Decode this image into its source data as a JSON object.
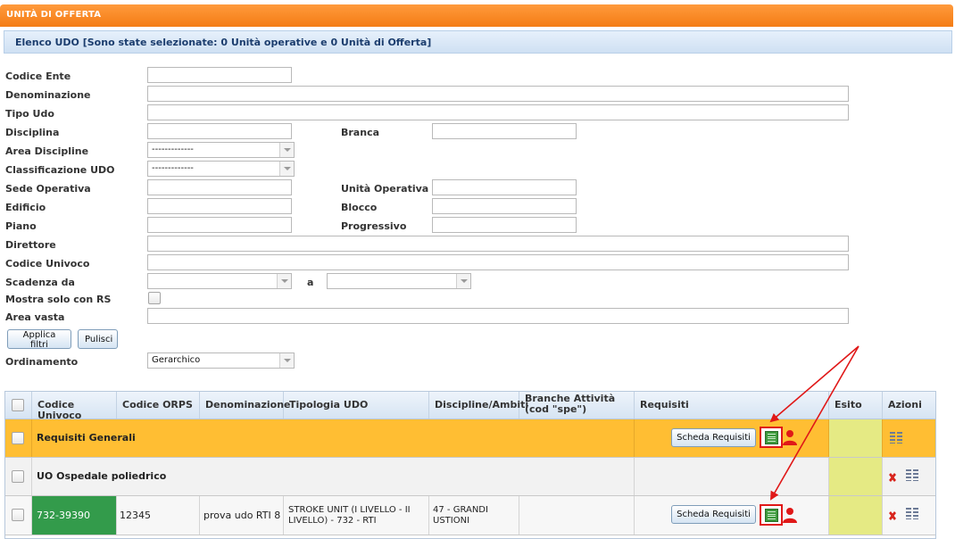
{
  "header": {
    "title": "UNITÀ DI OFFERTA",
    "subtitle": "Elenco UDO [Sono state selezionate: 0 Unità operative e 0 Unità di Offerta]"
  },
  "filters": {
    "codice_ente": {
      "label": "Codice Ente",
      "value": ""
    },
    "denominazione": {
      "label": "Denominazione",
      "value": ""
    },
    "tipo_udo": {
      "label": "Tipo Udo",
      "value": ""
    },
    "disciplina": {
      "label": "Disciplina",
      "value": ""
    },
    "branca": {
      "label": "Branca",
      "value": ""
    },
    "area_discipline": {
      "label": "Area Discipline",
      "value": "-------------"
    },
    "classificazione_udo": {
      "label": "Classificazione UDO",
      "value": "-------------"
    },
    "sede_operativa": {
      "label": "Sede Operativa",
      "value": ""
    },
    "unita_operativa": {
      "label": "Unità Operativa",
      "value": ""
    },
    "edificio": {
      "label": "Edificio",
      "value": ""
    },
    "blocco": {
      "label": "Blocco",
      "value": ""
    },
    "piano": {
      "label": "Piano",
      "value": ""
    },
    "progressivo": {
      "label": "Progressivo",
      "value": ""
    },
    "direttore": {
      "label": "Direttore",
      "value": ""
    },
    "codice_univoco": {
      "label": "Codice Univoco",
      "value": ""
    },
    "scadenza_da": {
      "label": "Scadenza da",
      "value": ""
    },
    "scadenza_a": {
      "label": "a",
      "value": ""
    },
    "mostra_solo_rs": {
      "label": "Mostra solo con RS",
      "checked": false
    },
    "area_vasta": {
      "label": "Area vasta",
      "value": ""
    },
    "applica_label": "Applica filtri",
    "pulisci_label": "Pulisci",
    "ordinamento": {
      "label": "Ordinamento",
      "value": "Gerarchico"
    }
  },
  "table": {
    "columns": [
      "Codice Univoco",
      "Codice ORPS",
      "Denominazione",
      "Tipologia UDO",
      "Discipline/Ambiti",
      "Branche Attività (cod \"spe\")",
      "Requisiti",
      "Esito",
      "Azioni"
    ],
    "scheda_label": "Scheda Requisiti",
    "rows": [
      {
        "title": "Requisiti Generali"
      },
      {
        "title": "UO Ospedale poliedrico"
      },
      {
        "codice_univoco": "732-39390",
        "codice_orps": "12345",
        "denominazione": "prova udo RTI 8",
        "tipologia": "STROKE UNIT (I LIVELLO - II LIVELLO) - 732 - RTI",
        "discipline": "47 - GRANDI USTIONI",
        "branche": ""
      }
    ]
  },
  "colors": {
    "header_orange": "#f47c14",
    "row_highlight": "#ffbe33",
    "esito_cell": "#e5ea84",
    "code_cell": "#339b4b",
    "annotation_red": "#e01818"
  },
  "icons": [
    "list-icon",
    "grid-requisiti-icon",
    "user-icon",
    "delete-icon",
    "columns-icon",
    "chevron-down-icon"
  ]
}
